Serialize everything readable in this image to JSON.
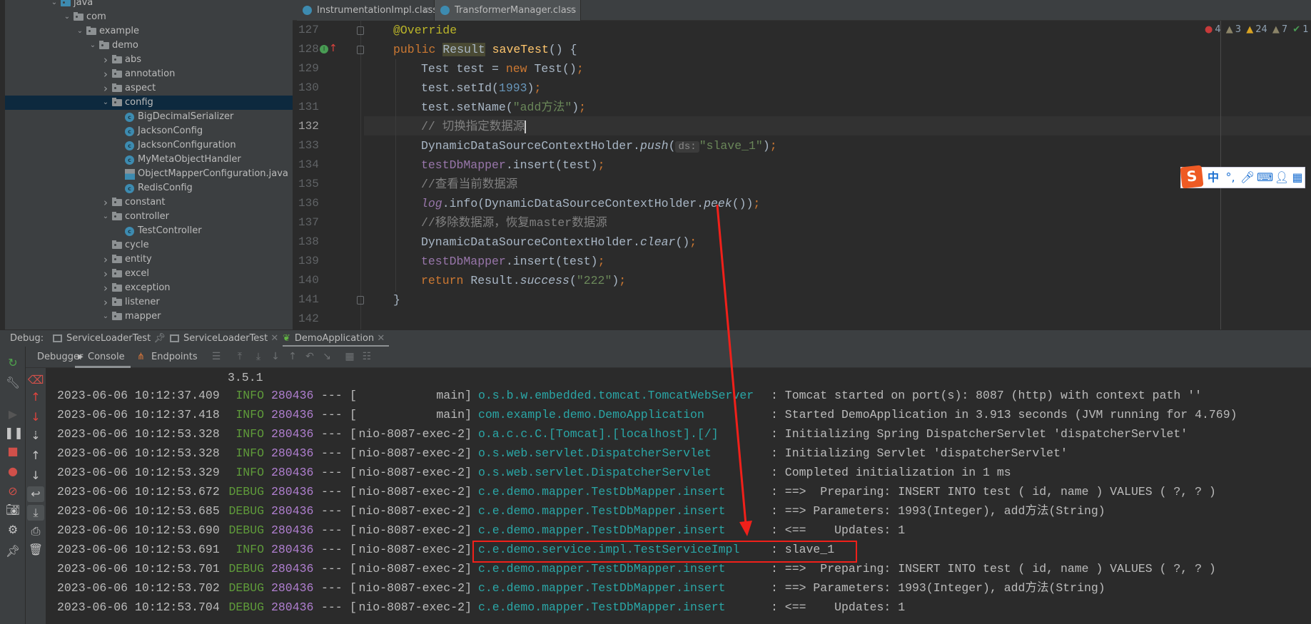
{
  "project_tree": [
    {
      "level": 0,
      "type": "source",
      "state": "open",
      "label": "java"
    },
    {
      "level": 1,
      "type": "folder",
      "state": "open",
      "label": "com"
    },
    {
      "level": 2,
      "type": "folder",
      "state": "open",
      "label": "example"
    },
    {
      "level": 3,
      "type": "folder",
      "state": "open",
      "label": "demo"
    },
    {
      "level": 4,
      "type": "folder",
      "state": "closed",
      "label": "abs"
    },
    {
      "level": 4,
      "type": "folder",
      "state": "closed",
      "label": "annotation"
    },
    {
      "level": 4,
      "type": "folder",
      "state": "closed",
      "label": "aspect"
    },
    {
      "level": 4,
      "type": "folder",
      "state": "open",
      "label": "config",
      "selected": true
    },
    {
      "level": 5,
      "type": "class",
      "state": "none",
      "label": "BigDecimalSerializer"
    },
    {
      "level": 5,
      "type": "class",
      "state": "none",
      "label": "JacksonConfig"
    },
    {
      "level": 5,
      "type": "class",
      "state": "none",
      "label": "JacksonConfiguration"
    },
    {
      "level": 5,
      "type": "class",
      "state": "none",
      "label": "MyMetaObjectHandler"
    },
    {
      "level": 5,
      "type": "java",
      "state": "none",
      "label": "ObjectMapperConfiguration.java"
    },
    {
      "level": 5,
      "type": "class",
      "state": "none",
      "label": "RedisConfig"
    },
    {
      "level": 4,
      "type": "folder",
      "state": "closed",
      "label": "constant"
    },
    {
      "level": 4,
      "type": "folder",
      "state": "open",
      "label": "controller"
    },
    {
      "level": 5,
      "type": "class",
      "state": "none",
      "label": "TestController"
    },
    {
      "level": 4,
      "type": "folder",
      "state": "none",
      "label": "cycle"
    },
    {
      "level": 4,
      "type": "folder",
      "state": "closed",
      "label": "entity"
    },
    {
      "level": 4,
      "type": "folder",
      "state": "closed",
      "label": "excel"
    },
    {
      "level": 4,
      "type": "folder",
      "state": "closed",
      "label": "exception"
    },
    {
      "level": 4,
      "type": "folder",
      "state": "closed",
      "label": "listener"
    },
    {
      "level": 4,
      "type": "folder",
      "state": "open",
      "label": "mapper"
    }
  ],
  "editor_tabs": [
    {
      "label": "InstrumentationImpl.class",
      "icon": "class-file-icon"
    },
    {
      "label": "TransformerManager.class",
      "icon": "class-file-icon"
    }
  ],
  "problems": {
    "errors": "4",
    "warnings": "3",
    "weak_warnings": "24",
    "typos": "7",
    "ok": "1"
  },
  "ime_toolbar": {
    "logo": "S",
    "mode": "中",
    "punct": "°,"
  },
  "code": {
    "current_line": "132",
    "lines": [
      {
        "n": "127",
        "indent": 0,
        "tokens": [
          {
            "t": "@Override",
            "c": "ann"
          }
        ]
      },
      {
        "n": "128",
        "indent": 0,
        "tokens": [
          {
            "t": "public ",
            "c": "kw"
          },
          {
            "t": "Result",
            "c": "hl"
          },
          {
            "t": " "
          },
          {
            "t": "saveTest",
            "c": "fn"
          },
          {
            "t": "() {"
          }
        ]
      },
      {
        "n": "129",
        "indent": 1,
        "tokens": [
          {
            "t": "Test test = "
          },
          {
            "t": "new ",
            "c": "kw"
          },
          {
            "t": "Test()"
          },
          {
            "t": ";",
            "c": "kw"
          }
        ]
      },
      {
        "n": "130",
        "indent": 1,
        "tokens": [
          {
            "t": "test.setId("
          },
          {
            "t": "1993",
            "c": "num"
          },
          {
            "t": ")"
          },
          {
            "t": ";",
            "c": "kw"
          }
        ]
      },
      {
        "n": "131",
        "indent": 1,
        "tokens": [
          {
            "t": "test.setName("
          },
          {
            "t": "\"add方法\"",
            "c": "str"
          },
          {
            "t": ")"
          },
          {
            "t": ";",
            "c": "kw"
          }
        ]
      },
      {
        "n": "132",
        "indent": 1,
        "tokens": [
          {
            "t": "// 切换指定数据源",
            "c": "cmt"
          }
        ],
        "caret": true
      },
      {
        "n": "133",
        "indent": 1,
        "tokens": [
          {
            "t": "DynamicDataSourceContextHolder."
          },
          {
            "t": "push",
            "c": "it"
          },
          {
            "t": "("
          },
          {
            "t": "ds:",
            "c": "hint"
          },
          {
            "t": "\"slave_1\"",
            "c": "str"
          },
          {
            "t": ")"
          },
          {
            "t": ";",
            "c": "kw"
          }
        ]
      },
      {
        "n": "134",
        "indent": 1,
        "tokens": [
          {
            "t": "testDbMapper",
            "c": "fld"
          },
          {
            "t": ".insert(test)"
          },
          {
            "t": ";",
            "c": "kw"
          }
        ]
      },
      {
        "n": "135",
        "indent": 1,
        "tokens": [
          {
            "t": "//查看当前数据源",
            "c": "cmt"
          }
        ]
      },
      {
        "n": "136",
        "indent": 1,
        "tokens": [
          {
            "t": "log",
            "c": "fld it"
          },
          {
            "t": ".info(DynamicDataSourceContextHolder."
          },
          {
            "t": "peek",
            "c": "it"
          },
          {
            "t": "())"
          },
          {
            "t": ";",
            "c": "kw"
          }
        ]
      },
      {
        "n": "137",
        "indent": 1,
        "tokens": [
          {
            "t": "//移除数据源，恢复master数据源",
            "c": "cmt"
          }
        ]
      },
      {
        "n": "138",
        "indent": 1,
        "tokens": [
          {
            "t": "DynamicDataSourceContextHolder."
          },
          {
            "t": "clear",
            "c": "it"
          },
          {
            "t": "()"
          },
          {
            "t": ";",
            "c": "kw"
          }
        ]
      },
      {
        "n": "139",
        "indent": 1,
        "tokens": [
          {
            "t": "testDbMapper",
            "c": "fld"
          },
          {
            "t": ".insert(test)"
          },
          {
            "t": ";",
            "c": "kw"
          }
        ]
      },
      {
        "n": "140",
        "indent": 1,
        "tokens": [
          {
            "t": "return ",
            "c": "kw"
          },
          {
            "t": "Result."
          },
          {
            "t": "success",
            "c": "it"
          },
          {
            "t": "("
          },
          {
            "t": "\"222\"",
            "c": "str"
          },
          {
            "t": ")"
          },
          {
            "t": ";",
            "c": "kw"
          }
        ]
      },
      {
        "n": "141",
        "indent": 0,
        "tokens": [
          {
            "t": "}"
          }
        ]
      },
      {
        "n": "142",
        "indent": 0,
        "tokens": []
      }
    ]
  },
  "debug_panel": {
    "label": "Debug:",
    "tabs": [
      {
        "label": "ServiceLoaderTest",
        "pinned": true
      },
      {
        "label": "ServiceLoaderTest",
        "closable": true
      },
      {
        "label": "DemoApplication",
        "closable": true,
        "active": true
      }
    ],
    "subtabs": [
      {
        "label": "Debugger"
      },
      {
        "label": "Console",
        "active": true
      },
      {
        "label": "Endpoints"
      }
    ]
  },
  "console": {
    "banner_version": "3.5.1",
    "lines": [
      {
        "date": "2023-06-06 10:12:37.409",
        "level": "INFO",
        "pid": "280436",
        "sep": "---",
        "thread": "main",
        "logger": "o.s.b.w.embedded.tomcat.TomcatWebServer",
        "message": ": Tomcat started on port(s): 8087 (http) with context path ''"
      },
      {
        "date": "2023-06-06 10:12:37.418",
        "level": "INFO",
        "pid": "280436",
        "sep": "---",
        "thread": "main",
        "logger": "com.example.demo.DemoApplication",
        "message": ": Started DemoApplication in 3.913 seconds (JVM running for 4.769)"
      },
      {
        "date": "2023-06-06 10:12:53.328",
        "level": "INFO",
        "pid": "280436",
        "sep": "---",
        "thread": "nio-8087-exec-2",
        "logger": "o.a.c.c.C.[Tomcat].[localhost].[/]",
        "message": ": Initializing Spring DispatcherServlet 'dispatcherServlet'"
      },
      {
        "date": "2023-06-06 10:12:53.328",
        "level": "INFO",
        "pid": "280436",
        "sep": "---",
        "thread": "nio-8087-exec-2",
        "logger": "o.s.web.servlet.DispatcherServlet",
        "message": ": Initializing Servlet 'dispatcherServlet'"
      },
      {
        "date": "2023-06-06 10:12:53.329",
        "level": "INFO",
        "pid": "280436",
        "sep": "---",
        "thread": "nio-8087-exec-2",
        "logger": "o.s.web.servlet.DispatcherServlet",
        "message": ": Completed initialization in 1 ms"
      },
      {
        "date": "2023-06-06 10:12:53.672",
        "level": "DEBUG",
        "pid": "280436",
        "sep": "---",
        "thread": "nio-8087-exec-2",
        "logger": "c.e.demo.mapper.TestDbMapper.insert",
        "message": ": ==>  Preparing: INSERT INTO test ( id, name ) VALUES ( ?, ? )"
      },
      {
        "date": "2023-06-06 10:12:53.685",
        "level": "DEBUG",
        "pid": "280436",
        "sep": "---",
        "thread": "nio-8087-exec-2",
        "logger": "c.e.demo.mapper.TestDbMapper.insert",
        "message": ": ==> Parameters: 1993(Integer), add方法(String)"
      },
      {
        "date": "2023-06-06 10:12:53.690",
        "level": "DEBUG",
        "pid": "280436",
        "sep": "---",
        "thread": "nio-8087-exec-2",
        "logger": "c.e.demo.mapper.TestDbMapper.insert",
        "message": ": <==    Updates: 1"
      },
      {
        "date": "2023-06-06 10:12:53.691",
        "level": "INFO",
        "pid": "280436",
        "sep": "---",
        "thread": "nio-8087-exec-2",
        "logger": "c.e.demo.service.impl.TestServiceImpl",
        "message": ": slave_1",
        "highlighted": true
      },
      {
        "date": "2023-06-06 10:12:53.701",
        "level": "DEBUG",
        "pid": "280436",
        "sep": "---",
        "thread": "nio-8087-exec-2",
        "logger": "c.e.demo.mapper.TestDbMapper.insert",
        "message": ": ==>  Preparing: INSERT INTO test ( id, name ) VALUES ( ?, ? )"
      },
      {
        "date": "2023-06-06 10:12:53.702",
        "level": "DEBUG",
        "pid": "280436",
        "sep": "---",
        "thread": "nio-8087-exec-2",
        "logger": "c.e.demo.mapper.TestDbMapper.insert",
        "message": ": ==> Parameters: 1993(Integer), add方法(String)"
      },
      {
        "date": "2023-06-06 10:12:53.704",
        "level": "DEBUG",
        "pid": "280436",
        "sep": "---",
        "thread": "nio-8087-exec-2",
        "logger": "c.e.demo.mapper.TestDbMapper.insert",
        "message": ": <==    Updates: 1"
      }
    ]
  },
  "annotation_color": "#f0201a"
}
